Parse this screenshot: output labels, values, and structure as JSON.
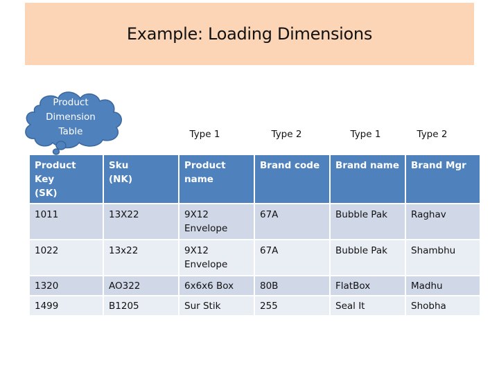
{
  "slide": {
    "title": "Example: Loading Dimensions",
    "callout": {
      "lines": [
        "Product",
        "Dimension",
        "Table"
      ],
      "color": "#4f81bd"
    },
    "scd_types": [
      "Type 1",
      "Type 2",
      "Type 1",
      "Type 2"
    ],
    "table": {
      "headers": [
        [
          "Product Key",
          "(SK)"
        ],
        [
          "Sku",
          "(NK)"
        ],
        [
          "Product",
          "name"
        ],
        [
          "Brand code"
        ],
        [
          "Brand name"
        ],
        [
          "Brand Mgr"
        ]
      ],
      "rows": [
        {
          "product_key": "1011",
          "sku": "13X22",
          "product_name": [
            "9X12",
            "Envelope"
          ],
          "brand_code": "67A",
          "brand_name": "Bubble Pak",
          "brand_mgr": "Raghav"
        },
        {
          "product_key": "1022",
          "sku": "13x22",
          "product_name": [
            "9X12",
            "Envelope"
          ],
          "brand_code": "67A",
          "brand_name": "Bubble Pak",
          "brand_mgr": "Shambhu"
        },
        {
          "product_key": "1320",
          "sku": "AO322",
          "product_name": [
            "6x6x6 Box"
          ],
          "brand_code": "80B",
          "brand_name": "FlatBox",
          "brand_mgr": "Madhu"
        },
        {
          "product_key": "1499",
          "sku": "B1205",
          "product_name": [
            "Sur Stik"
          ],
          "brand_code": "255",
          "brand_name": "Seal It",
          "brand_mgr": "Shobha"
        }
      ]
    },
    "colors": {
      "title_band": "#fbd5b5",
      "header_fill": "#4f81bd",
      "row_odd": "#d0d8e8",
      "row_even": "#e9edf4"
    }
  }
}
